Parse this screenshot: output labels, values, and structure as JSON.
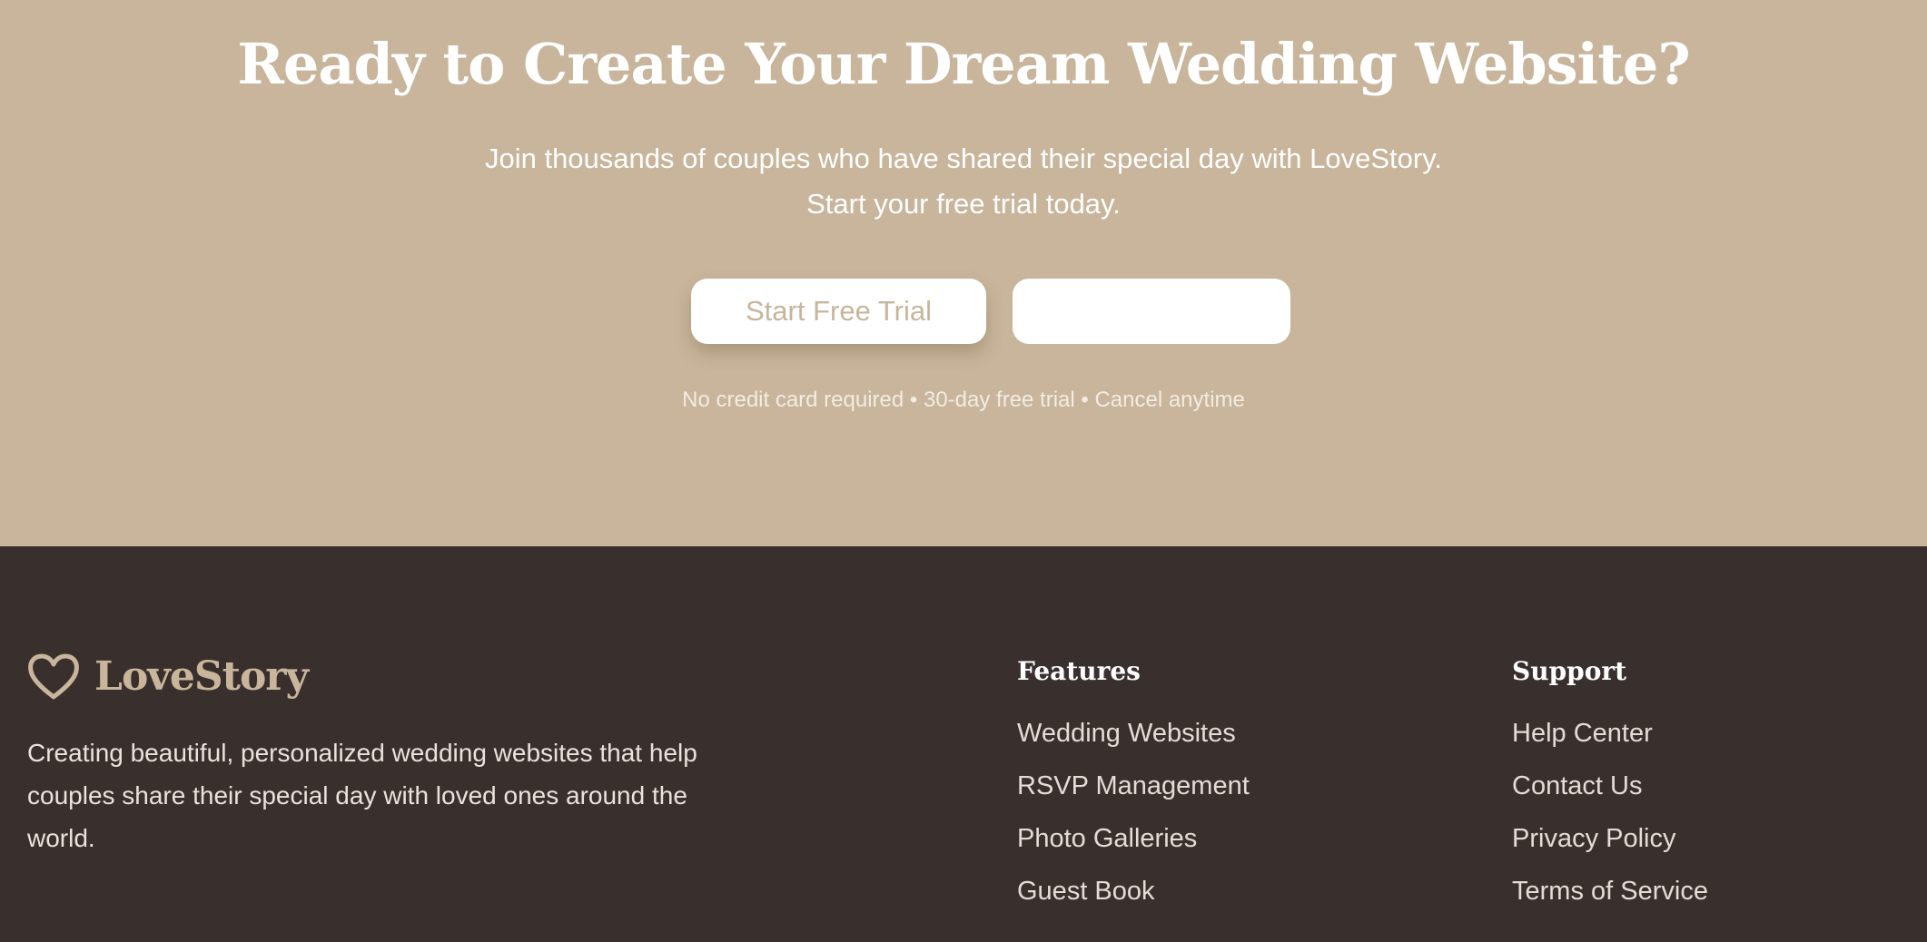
{
  "cta": {
    "title": "Ready to Create Your Dream Wedding Website?",
    "subtitle": "Join thousands of couples who have shared their special day with LoveStory. Start your free trial today.",
    "primary_button": "Start Free Trial",
    "secondary_button": "",
    "note": "No credit card required • 30-day free trial • Cancel anytime"
  },
  "footer": {
    "brand_name": "LoveStory",
    "brand_icon": "heart-outline-icon",
    "description": "Creating beautiful, personalized wedding websites that help couples share their special day with loved ones around the world.",
    "columns": [
      {
        "title": "Features",
        "links": [
          "Wedding Websites",
          "RSVP Management",
          "Photo Galleries",
          "Guest Book"
        ]
      },
      {
        "title": "Support",
        "links": [
          "Help Center",
          "Contact Us",
          "Privacy Policy",
          "Terms of Service"
        ]
      }
    ]
  },
  "colors": {
    "cta_background": "#c8b59b",
    "footer_background": "#39302d",
    "accent": "#c8b59b",
    "button_background": "#ffffff"
  }
}
